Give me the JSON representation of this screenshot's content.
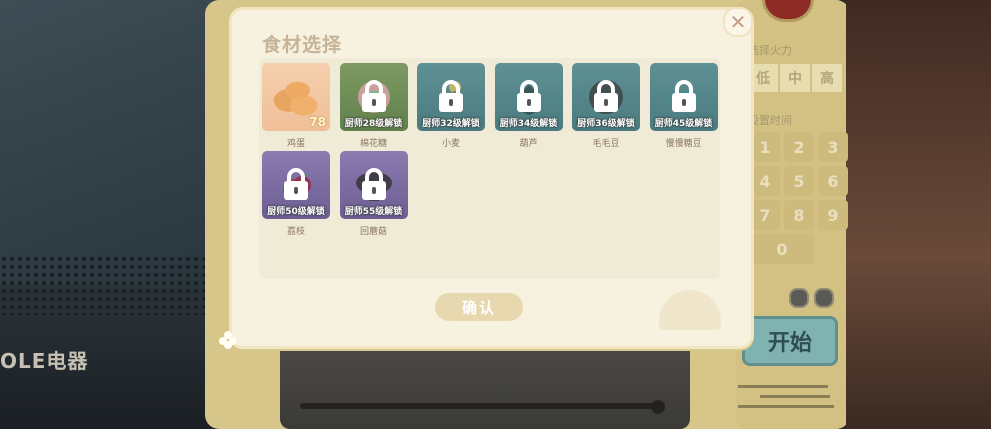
{
  "background": {
    "brand_text": "OLE电器",
    "heat_label": "选择火力",
    "heat_options": [
      "低",
      "中",
      "高"
    ],
    "time_label": "设置时间",
    "keypad_keys": [
      "1",
      "2",
      "3",
      "4",
      "5",
      "6",
      "7",
      "8",
      "9",
      "0"
    ],
    "start_label": "开始"
  },
  "dialog": {
    "title": "食材选择",
    "close_label": "✕",
    "confirm_label": "确认",
    "items": [
      {
        "name": "鸡蛋",
        "quantity": "78",
        "locked": false,
        "unlock_text": "",
        "tile": "orange",
        "icon": "egg-icon"
      },
      {
        "name": "棉花糖",
        "quantity": "",
        "locked": true,
        "unlock_text": "厨师28级解锁",
        "tile": "green",
        "icon": "marshmallow-icon"
      },
      {
        "name": "小麦",
        "quantity": "",
        "locked": true,
        "unlock_text": "厨师32级解锁",
        "tile": "teal",
        "icon": "wheat-icon"
      },
      {
        "name": "葫芦",
        "quantity": "",
        "locked": true,
        "unlock_text": "厨师34级解锁",
        "tile": "teal",
        "icon": "gourd-icon"
      },
      {
        "name": "毛毛豆",
        "quantity": "",
        "locked": true,
        "unlock_text": "厨师36级解锁",
        "tile": "teal",
        "icon": "edamame-icon"
      },
      {
        "name": "慢慢糖豆",
        "quantity": "",
        "locked": true,
        "unlock_text": "厨师45级解锁",
        "tile": "teal",
        "icon": "candy-icon"
      },
      {
        "name": "荔枝",
        "quantity": "",
        "locked": true,
        "unlock_text": "厨师50级解锁",
        "tile": "purple",
        "icon": "lychee-icon"
      },
      {
        "name": "回蘑菇",
        "quantity": "",
        "locked": true,
        "unlock_text": "厨师55级解锁",
        "tile": "purple",
        "icon": "mushroom-icon"
      }
    ]
  },
  "colors": {
    "dialog_bg": "#f7f1df",
    "title": "#c6b499",
    "tile_teal": "#5f9094",
    "tile_purple": "#8b7bb0",
    "tile_green": "#7d9a63",
    "egg_tile": "#f5cfae",
    "confirm_button": "#e8d8b0",
    "start_button": "#7fb2b1"
  }
}
